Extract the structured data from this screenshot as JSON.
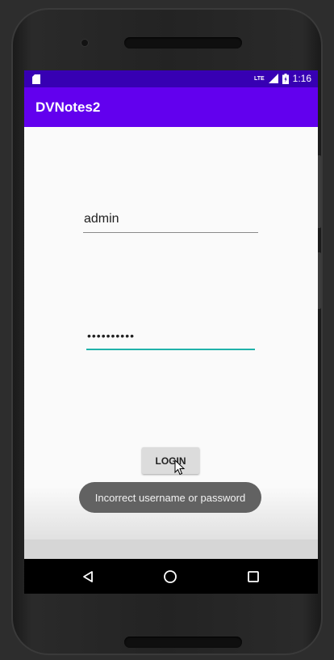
{
  "statusbar": {
    "network_label": "LTE",
    "time": "1:16"
  },
  "app": {
    "title": "DVNotes2"
  },
  "form": {
    "username_value": "admin",
    "password_value": "••••••••••",
    "login_label": "LOGIN"
  },
  "toast": {
    "message": "Incorrect username or password"
  },
  "navbar": {
    "back_icon": "back-triangle-icon",
    "home_icon": "home-circle-icon",
    "recent_icon": "recent-apps-square-icon"
  },
  "colors": {
    "status_bar": "#3700b3",
    "app_bar": "#6200ee",
    "input_focus": "#20b2aa",
    "toast_bg": "#626262"
  }
}
